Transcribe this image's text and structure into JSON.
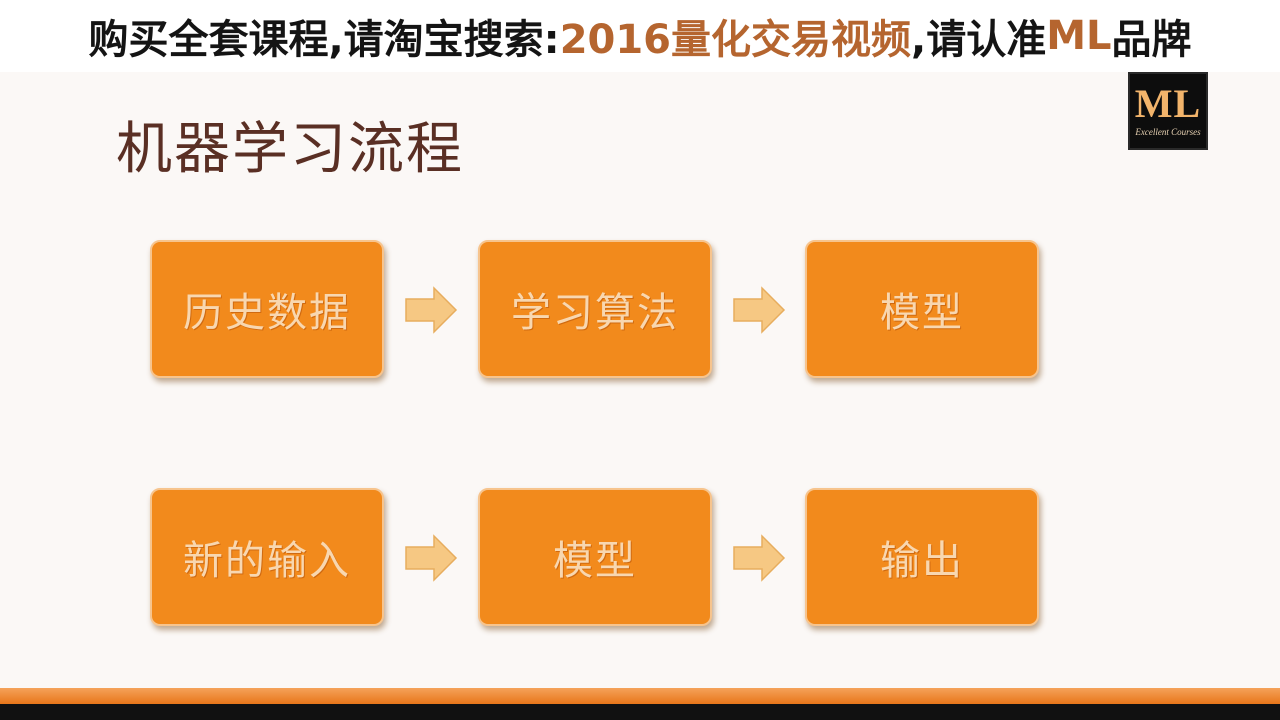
{
  "banner": {
    "part1": "购买全套课程,请淘宝搜索:",
    "part2": "2016量化交易视频",
    "part3": ",请认准",
    "part4": "ML",
    "part5": "品牌"
  },
  "logo": {
    "mark": "ML",
    "subtitle": "Excellent Courses"
  },
  "slide": {
    "title": "机器学习流程"
  },
  "flow": {
    "row1": [
      "历史数据",
      "学习算法",
      "模型"
    ],
    "row2": [
      "新的输入",
      "模型",
      "输出"
    ]
  },
  "colors": {
    "box_fill": "#f28a1c",
    "box_text": "#f8d7b0",
    "arrow_fill": "#f6c883",
    "title_text": "#5a2f24",
    "banner_accent": "#b5652f"
  },
  "icons": {
    "flow_arrow": "arrow-right-icon"
  }
}
